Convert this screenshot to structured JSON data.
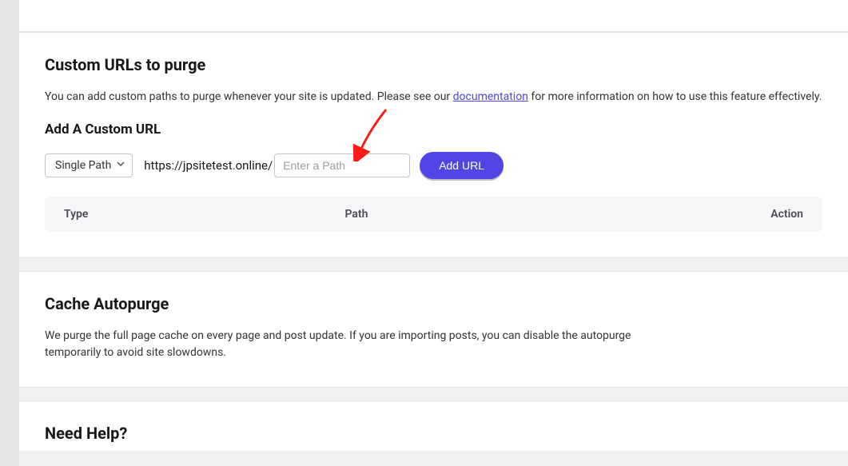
{
  "customUrls": {
    "heading": "Custom URLs to purge",
    "descPrefix": "You can add custom paths to purge whenever your site is updated. Please see our ",
    "docLinkText": "documentation",
    "descSuffix": " for more information on how to use this feature effectively.",
    "addHeading": "Add A Custom URL",
    "selectValue": "Single Path",
    "urlPrefix": "https://jpsitetest.online/",
    "pathPlaceholder": "Enter a Path",
    "addButton": "Add URL",
    "table": {
      "colType": "Type",
      "colPath": "Path",
      "colAction": "Action"
    }
  },
  "cacheAutopurge": {
    "heading": "Cache Autopurge",
    "desc": "We purge the full page cache on every page and post update. If you are importing posts, you can disable the autopurge temporarily to avoid site slowdowns."
  },
  "needHelp": {
    "heading": "Need Help?"
  }
}
